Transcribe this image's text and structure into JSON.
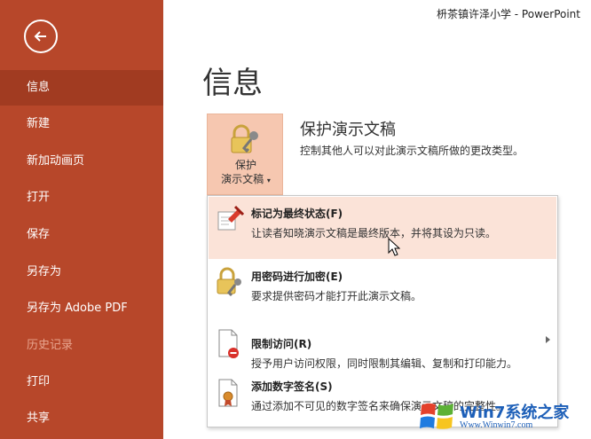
{
  "window": {
    "title": "枡茶镇许泽小学  -  PowerPoint"
  },
  "sidebar": {
    "items": [
      {
        "label": "信息",
        "active": true
      },
      {
        "label": "新建"
      },
      {
        "label": "新加动画页"
      },
      {
        "label": "打开"
      },
      {
        "label": "保存"
      },
      {
        "label": "另存为"
      },
      {
        "label": "另存为 Adobe PDF"
      },
      {
        "label": "历史记录",
        "dim": true
      },
      {
        "label": "打印"
      },
      {
        "label": "共享"
      }
    ]
  },
  "main": {
    "title": "信息",
    "protect": {
      "button_line1": "保护",
      "button_line2": "演示文稿",
      "caret": "▾",
      "section_title": "保护演示文稿",
      "section_desc": "控制其他人可以对此演示文稿所做的更改类型。"
    },
    "menu": [
      {
        "title": "标记为最终状态(F)",
        "desc": "让读者知晓演示文稿是最终版本，并将其设为只读。",
        "icon": "final-mark-icon"
      },
      {
        "title": "用密码进行加密(E)",
        "desc": "要求提供密码才能打开此演示文稿。",
        "icon": "lock-key-icon"
      },
      {
        "title": "限制访问(R)",
        "desc": "授予用户访问权限，同时限制其编辑、复制和打印能力。",
        "icon": "restrict-access-icon"
      },
      {
        "title": "添加数字签名(S)",
        "desc": "通过添加不可见的数字签名来确保演示文稿的完整性。",
        "icon": "digital-signature-icon"
      }
    ]
  },
  "watermark": {
    "text": "Win7系统之家",
    "url": "Www.Winwin7.com"
  },
  "colors": {
    "sidebar": "#b7472a",
    "sidebar_active": "#a13b21",
    "highlight": "#fbe3d8",
    "button_bg": "#f6c7b0"
  }
}
